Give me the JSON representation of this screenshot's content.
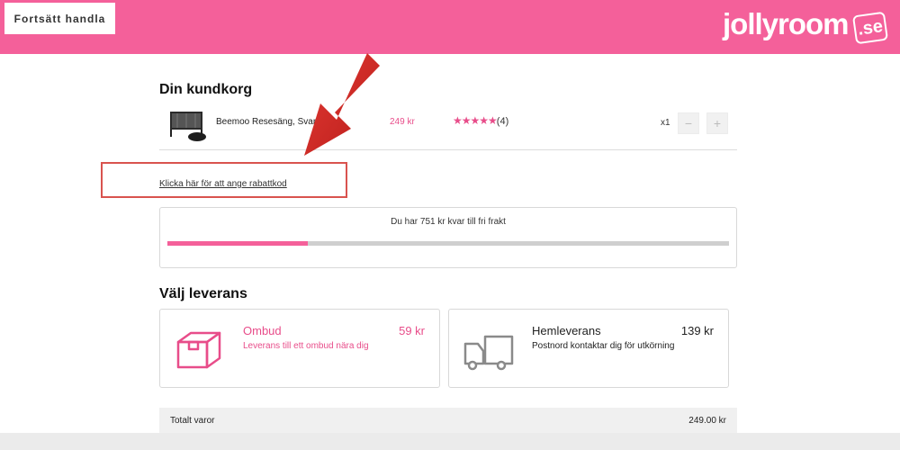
{
  "header": {
    "continue_label": "Fortsätt handla",
    "logo_text": "jollyroom",
    "logo_badge": ".se",
    "brand_color": "#f4609a"
  },
  "cart": {
    "title": "Din kundkorg",
    "item": {
      "name": "Beemoo Resesäng, Svar",
      "price": "249 kr",
      "stars": "★★★★★",
      "rating_count": "(4)",
      "quantity": "x1",
      "minus_label": "−",
      "plus_label": "+"
    },
    "coupon_link": "Klicka här för att ange rabattkod"
  },
  "shipping": {
    "free_shipping_text": "Du har 751 kr kvar till fri frakt",
    "progress_fraction": 0.25
  },
  "delivery": {
    "title": "Välj leverans",
    "options": [
      {
        "name": "Ombud",
        "price": "59 kr",
        "description": "Leverans till ett ombud nära dig",
        "icon": "package-icon"
      },
      {
        "name": "Hemleverans",
        "price": "139 kr",
        "description": "Postnord kontaktar dig för utkörning",
        "icon": "truck-icon"
      }
    ]
  },
  "totals": {
    "label": "Totalt varor",
    "value": "249.00 kr"
  }
}
